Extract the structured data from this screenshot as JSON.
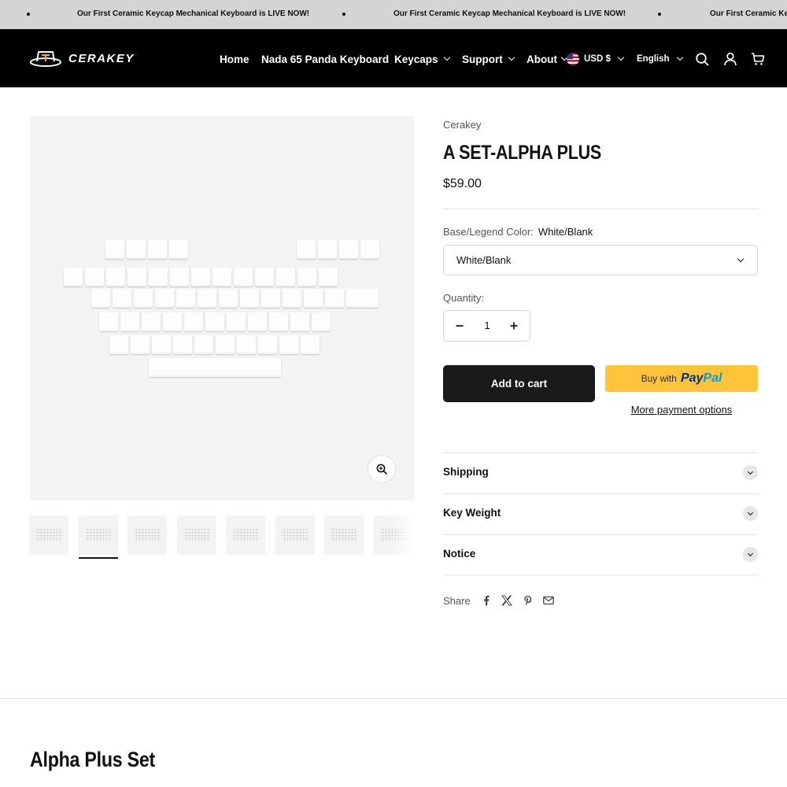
{
  "announcement": {
    "text": "Our First Ceramic Keycap Mechanical Keyboard is LIVE NOW!"
  },
  "header": {
    "brand": "CERAKEY",
    "nav": [
      {
        "label": "Home"
      },
      {
        "label": "Nada 65 Panda Keyboard"
      },
      {
        "label": "Keycaps"
      },
      {
        "label": "Support"
      },
      {
        "label": "About"
      }
    ],
    "currency": "USD $",
    "language": "English",
    "icons": [
      "search-icon",
      "account-icon",
      "cart-icon"
    ]
  },
  "product": {
    "vendor": "Cerakey",
    "title": "A SET-ALPHA PLUS",
    "price": "$59.00",
    "option": {
      "label": "Base/Legend Color:",
      "value": "White/Blank",
      "selected": "White/Blank"
    },
    "quantity": {
      "label": "Quantity:",
      "value": "1"
    },
    "add_to_cart": "Add to cart",
    "paypal": {
      "prefix": "Buy with",
      "brand_a": "Pay",
      "brand_b": "Pal"
    },
    "more_payment": "More payment options",
    "accordions": [
      {
        "title": "Shipping"
      },
      {
        "title": "Key Weight"
      },
      {
        "title": "Notice"
      }
    ],
    "share": {
      "label": "Share",
      "icons": [
        "facebook-icon",
        "x-icon",
        "pinterest-icon",
        "email-icon"
      ]
    }
  },
  "gallery": {
    "thumbnail_count": 8,
    "active_thumbnail": 2
  },
  "section": {
    "title": "Alpha Plus Set"
  },
  "colors": {
    "header_bg": "#000000",
    "announce_bg": "#d4d4d4",
    "cart_button": "#1a1a1a",
    "paypal": "#ffc439"
  }
}
